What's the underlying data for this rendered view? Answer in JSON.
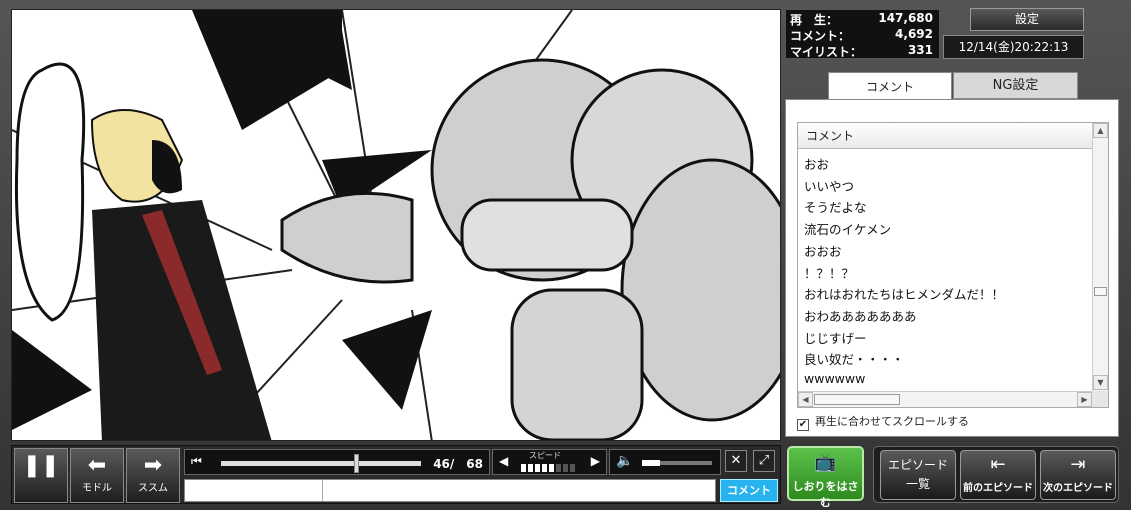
{
  "stats": {
    "views_label": "再　生：",
    "views_value": "147,680",
    "comments_label": "コメント：",
    "comments_value": "4,692",
    "mylist_label": "マイリスト：",
    "mylist_value": "331"
  },
  "header": {
    "settings_label": "設定",
    "datetime": "12/14(金)20:22:13"
  },
  "comment_panel": {
    "tabs": [
      {
        "label": "コメント",
        "active": true
      },
      {
        "label": "NG設定",
        "active": false
      }
    ],
    "column_header": "コメント",
    "comments": [
      "おお",
      "いいやつ",
      "そうだよな",
      "流石のイケメン",
      "おおお",
      "！？！？",
      "おれはおれたちはヒメンダムだ！！",
      "おわあああああああ",
      "じじすげー",
      "良い奴だ・・・・",
      "wwwwww"
    ],
    "autoscroll_label": "再生に合わせてスクロールする",
    "autoscroll_checked": true
  },
  "controls": {
    "pause_icon": "pause-icon",
    "back_label": "モドル",
    "forward_label": "ススム",
    "time_display": "46/　68",
    "seek_fraction": 0.676,
    "speed_label": "スピード",
    "speed_level": 5,
    "speed_max": 8,
    "volume_fraction": 0.25,
    "comment_send_label": "コメント",
    "comment_input_value": "",
    "command_input_value": ""
  },
  "side_buttons": {
    "bookmark_label": "しおりをはさむ",
    "episode_list_line1": "エピソード",
    "episode_list_line2": "一覧",
    "prev_episode_label": "前のエピソード",
    "next_episode_label": "次のエピソード"
  },
  "colors": {
    "send_button": "#27b3f0",
    "bookmark_button": "#3fa52f"
  }
}
